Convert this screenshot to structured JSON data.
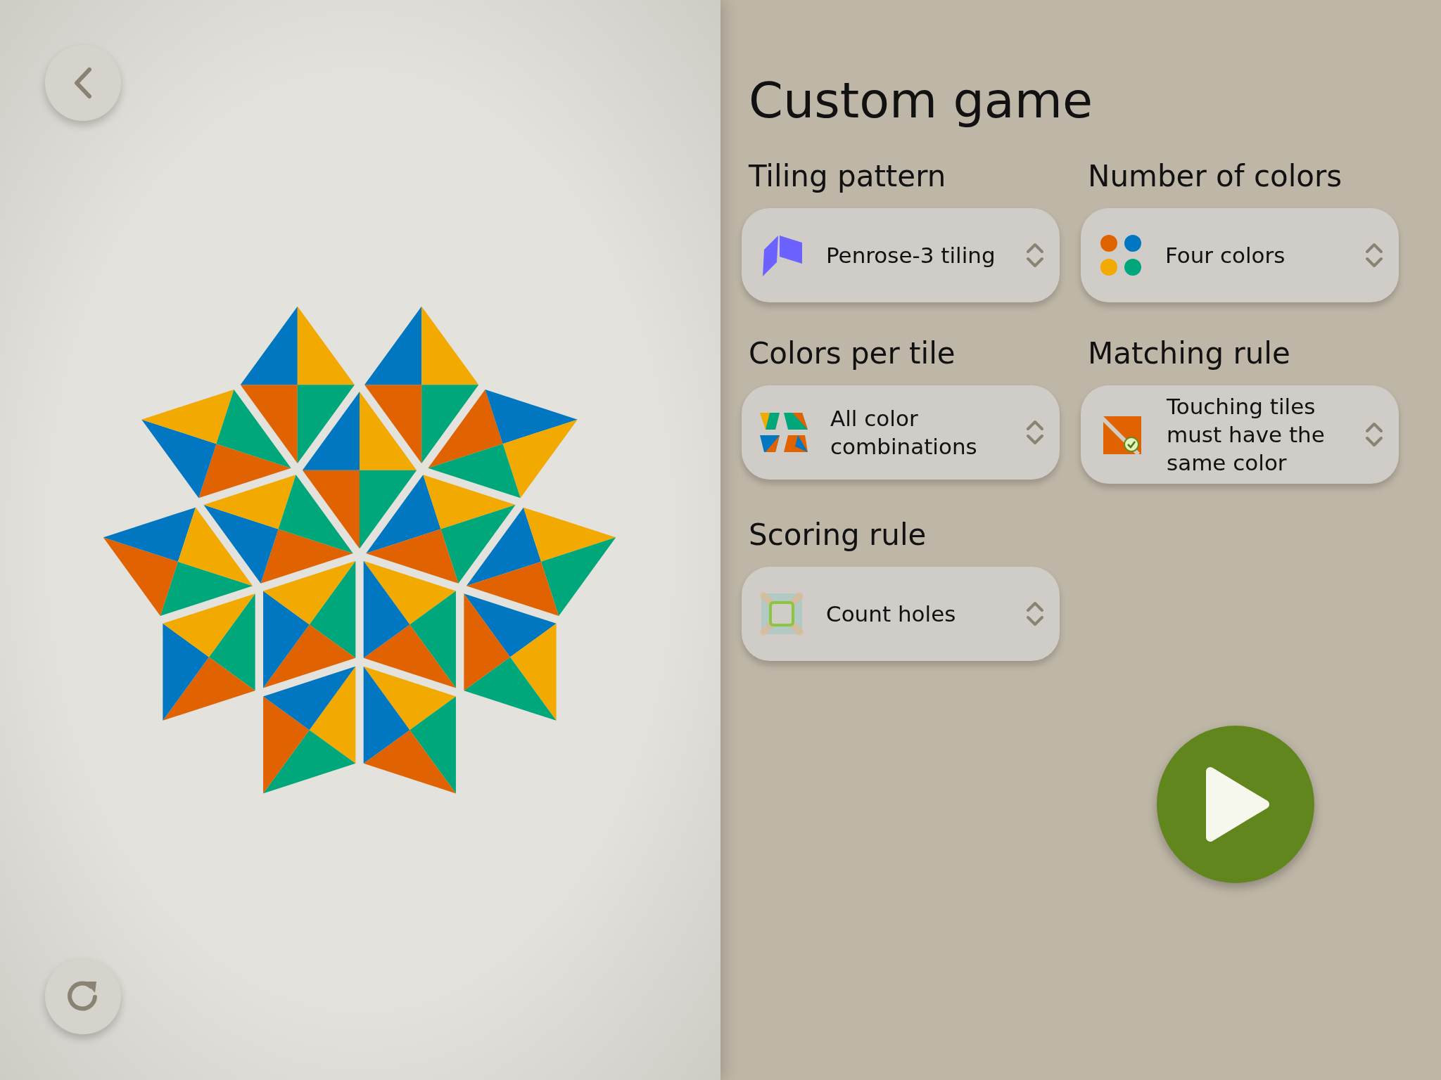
{
  "title": "Custom game",
  "settings": [
    {
      "label": "Tiling pattern",
      "value": "Penrose-3 tiling",
      "kind": "penrose"
    },
    {
      "label": "Number of colors",
      "value": "Four colors",
      "kind": "colors"
    },
    {
      "label": "Colors per tile",
      "value": "All color combinations",
      "kind": "combos"
    },
    {
      "label": "Matching rule",
      "value": "Touching tiles must have the same color",
      "kind": "matching"
    },
    {
      "label": "Scoring rule",
      "value": "Count holes",
      "kind": "holes"
    }
  ]
}
